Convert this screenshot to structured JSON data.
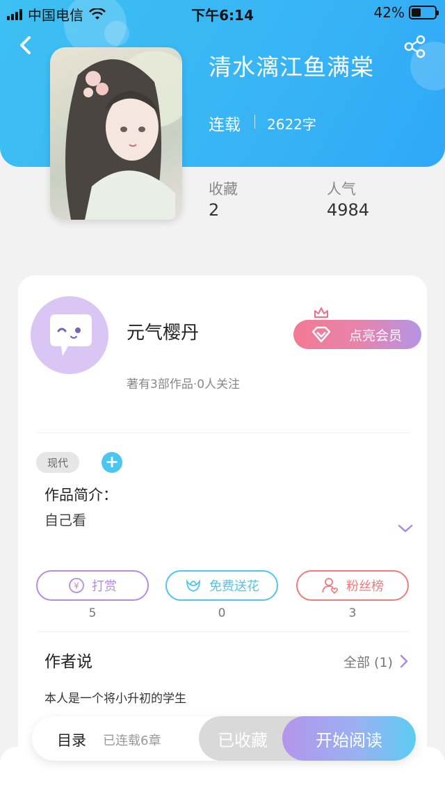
{
  "status_bar": {
    "carrier": "中国电信",
    "time": "下午6:14",
    "battery_percent": "42%",
    "battery_level": 0.42
  },
  "book": {
    "title": "清水漓江鱼满棠",
    "status": "连载",
    "word_count": "2622字"
  },
  "stats": [
    {
      "label": "收藏",
      "value": "2"
    },
    {
      "label": "人气",
      "value": "4984"
    }
  ],
  "author": {
    "name": "元气樱丹",
    "meta": "著有3部作品·0人关注",
    "vip_label": "点亮会员"
  },
  "tags": [
    "现代"
  ],
  "intro": {
    "title": "作品简介：",
    "text": "自己看"
  },
  "actions": [
    {
      "label": "打赏",
      "count": "5",
      "color": "#b48be0",
      "icon": "yuan-coin-icon"
    },
    {
      "label": "免费送花",
      "count": "0",
      "color": "#4cc6f0",
      "icon": "flower-icon"
    },
    {
      "label": "粉丝榜",
      "count": "3",
      "color": "#ee7a7a",
      "icon": "fan-user-icon"
    }
  ],
  "author_says": {
    "title": "作者说",
    "see_all": "全部 (1)",
    "text": "本人是一个将小升初的学生"
  },
  "bottom_bar": {
    "toc_label": "目录",
    "toc_meta": "已连载6章",
    "favorite_label": "已收藏",
    "read_label": "开始阅读"
  },
  "colors": {
    "header_blue": "#38b4f5",
    "accent_purple": "#b495ec",
    "accent_cyan": "#4cc6f0"
  }
}
